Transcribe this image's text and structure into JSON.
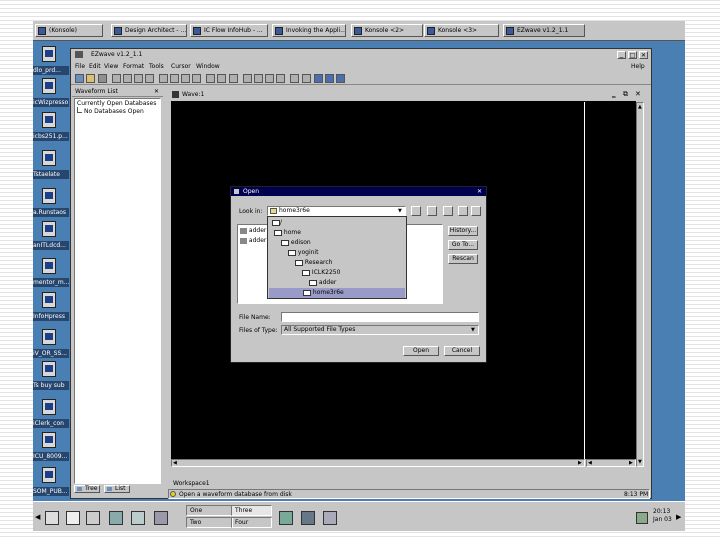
{
  "taskbar": {
    "items": [
      {
        "label": "(Konsole)"
      },
      {
        "label": "Design Architect - ..."
      },
      {
        "label": "IC Flow InfoHub - ..."
      },
      {
        "label": "Invoking the Appli..."
      },
      {
        "label": "Konsole <2>"
      },
      {
        "label": "Konsole <3>"
      },
      {
        "label": "EZwave  v1.2_1.1"
      }
    ]
  },
  "desktop_icons": [
    {
      "label": "dlo_prd..."
    },
    {
      "label": "icWizpresso"
    },
    {
      "label": "icbs251.p..."
    },
    {
      "label": "Tstaelate"
    },
    {
      "label": "a.Runstaos"
    },
    {
      "label": "anITLdcd..."
    },
    {
      "label": "mentor_m..."
    },
    {
      "label": "InfoHpress"
    },
    {
      "label": "iV_OR_SS..."
    },
    {
      "label": "Ts buy sub"
    },
    {
      "label": "iClerk_con"
    },
    {
      "label": "ICU_8009..."
    },
    {
      "label": "SOM_PUB..."
    }
  ],
  "app": {
    "title": "EZwave  v1.2_1.1",
    "menus": [
      "File",
      "Edit",
      "View",
      "Format",
      "Tools",
      "Cursor",
      "Window"
    ],
    "help": "Help",
    "waveform_list": {
      "title": "Waveform List",
      "tree_root": "Currently Open Databases",
      "tree_child": "No Databases Open",
      "tabs": [
        "Tree",
        "List"
      ]
    },
    "wave_title": "Wave:1",
    "workspace_tab": "Workspace1",
    "status_text": "Open a waveform database from disk",
    "status_time": "8:13 PM"
  },
  "dialog": {
    "title": "Open",
    "look_in_label": "Look in:",
    "look_in_value": "home3r6e",
    "dropdown_items": [
      "/",
      "home",
      "edison",
      "yoginit",
      "Research",
      "ICLK2250",
      "adder",
      "home3r6e"
    ],
    "file_items": [
      "adder",
      "adder"
    ],
    "buttons": {
      "history": "History...",
      "go_to": "Go To...",
      "rescan": "Rescan",
      "open": "Open",
      "cancel": "Cancel"
    },
    "file_name_label": "File Name:",
    "file_name_value": "",
    "files_type_label": "Files of Type:",
    "files_type_value": "All Supported File Types"
  },
  "bottom_bar": {
    "workspaces": [
      "One",
      "Three",
      "Two",
      "Four"
    ],
    "clock_time": "20:13",
    "clock_date": "Jan 03"
  }
}
